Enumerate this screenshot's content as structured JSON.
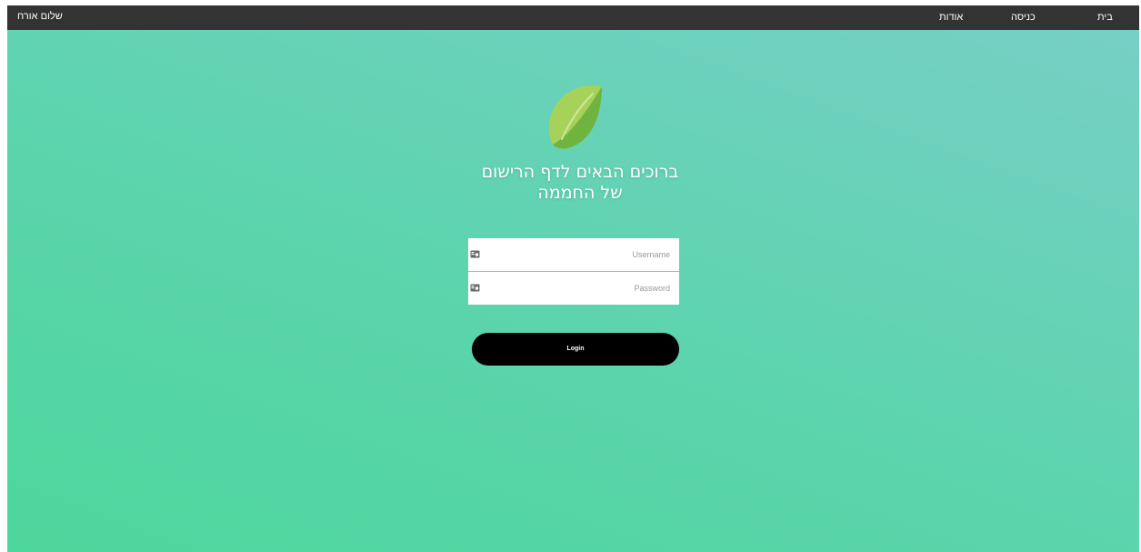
{
  "nav": {
    "greeting": "שלום אורח",
    "home": "בית",
    "login": "כניסה",
    "about": "אודות"
  },
  "hero": {
    "logo_icon": "leaf-logo",
    "title_line1": "ברוכים הבאים לדף הרישום",
    "title_line2": "של החממה"
  },
  "form": {
    "username_placeholder": "Username",
    "password_placeholder": "Password",
    "field_icon": "id-card-icon",
    "login_label": "Login"
  },
  "colors": {
    "nav_bg": "#333333",
    "gradient_start": "#4dd69c",
    "gradient_end": "#78cfc6",
    "button_bg": "#000000",
    "leaf_light": "#a6d25a",
    "leaf_dark": "#6fb43f"
  }
}
